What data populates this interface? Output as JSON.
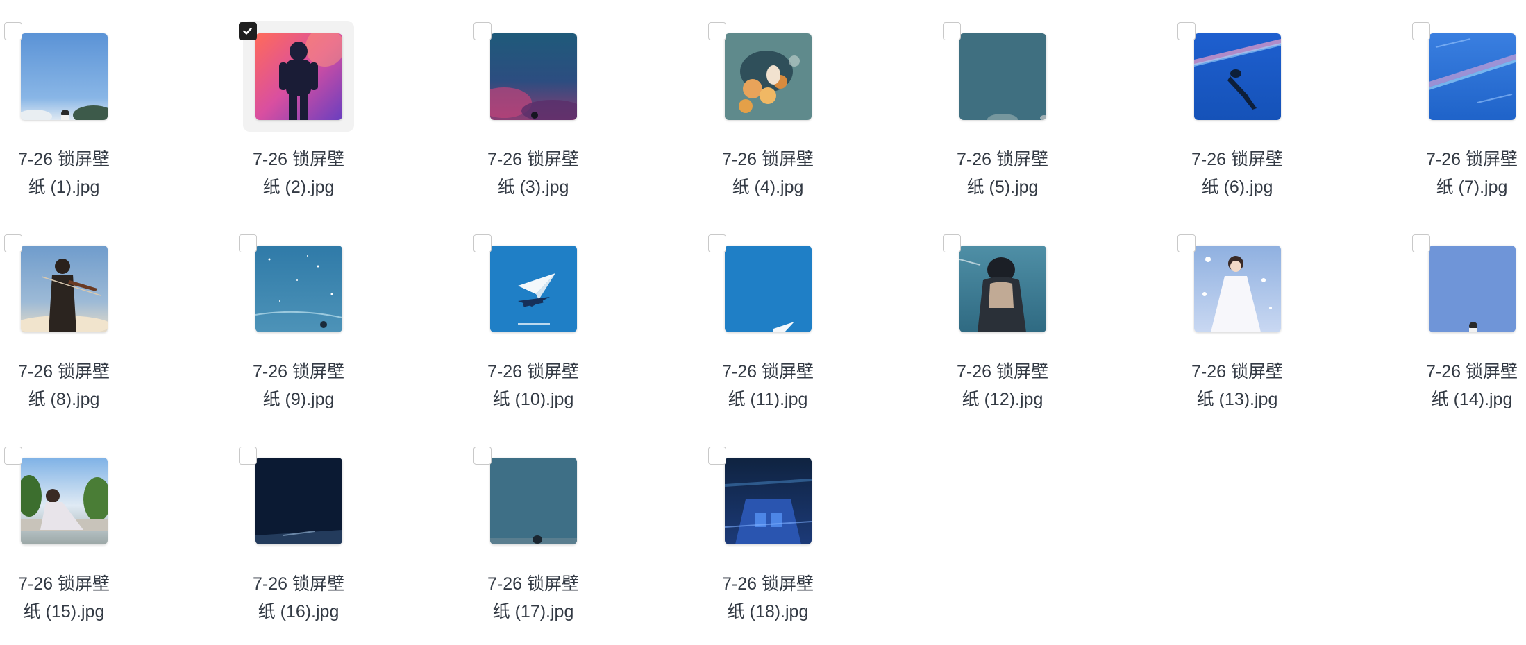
{
  "files": [
    {
      "line1": "7-26 锁屏壁",
      "line2": "纸 (1).jpg",
      "selected": false,
      "thumb": "sky-girl"
    },
    {
      "line1": "7-26 锁屏壁",
      "line2": "纸 (2).jpg",
      "selected": true,
      "thumb": "astronaut"
    },
    {
      "line1": "7-26 锁屏壁",
      "line2": "纸 (3).jpg",
      "selected": false,
      "thumb": "dusk-clouds"
    },
    {
      "line1": "7-26 锁屏壁",
      "line2": "纸 (4).jpg",
      "selected": false,
      "thumb": "flower-girl"
    },
    {
      "line1": "7-26 锁屏壁",
      "line2": "纸 (5).jpg",
      "selected": false,
      "thumb": "teal-plain"
    },
    {
      "line1": "7-26 锁屏壁",
      "line2": "纸 (6).jpg",
      "selected": false,
      "thumb": "falling-figure"
    },
    {
      "line1": "7-26 锁屏壁",
      "line2": "纸 (7).jpg",
      "selected": false,
      "thumb": "blue-streaks"
    },
    {
      "line1": "7-26 锁屏壁",
      "line2": "纸 (8).jpg",
      "selected": false,
      "thumb": "violinist"
    },
    {
      "line1": "7-26 锁屏壁",
      "line2": "纸 (9).jpg",
      "selected": false,
      "thumb": "sparkle-sea"
    },
    {
      "line1": "7-26 锁屏壁",
      "line2": "纸 (10).jpg",
      "selected": false,
      "thumb": "paper-plane"
    },
    {
      "line1": "7-26 锁屏壁",
      "line2": "纸 (11).jpg",
      "selected": false,
      "thumb": "blue-plane-corner"
    },
    {
      "line1": "7-26 锁屏壁",
      "line2": "纸 (12).jpg",
      "selected": false,
      "thumb": "girl-back"
    },
    {
      "line1": "7-26 锁屏壁",
      "line2": "纸 (13).jpg",
      "selected": false,
      "thumb": "bride-stage"
    },
    {
      "line1": "7-26 锁屏壁",
      "line2": "纸 (14).jpg",
      "selected": false,
      "thumb": "lavender-sky"
    },
    {
      "line1": "7-26 锁屏壁",
      "line2": "纸 (15).jpg",
      "selected": false,
      "thumb": "girl-trees"
    },
    {
      "line1": "7-26 锁屏壁",
      "line2": "纸 (16).jpg",
      "selected": false,
      "thumb": "dark-navy"
    },
    {
      "line1": "7-26 锁屏壁",
      "line2": "纸 (17).jpg",
      "selected": false,
      "thumb": "slate-horizon"
    },
    {
      "line1": "7-26 锁屏壁",
      "line2": "纸 (18).jpg",
      "selected": false,
      "thumb": "night-boat"
    }
  ],
  "colors": {
    "text": "#333a44",
    "checkbox_border": "#c9c9c9",
    "checkbox_checked": "#1f1f1f",
    "selected_tile": "#f2f2f2"
  }
}
